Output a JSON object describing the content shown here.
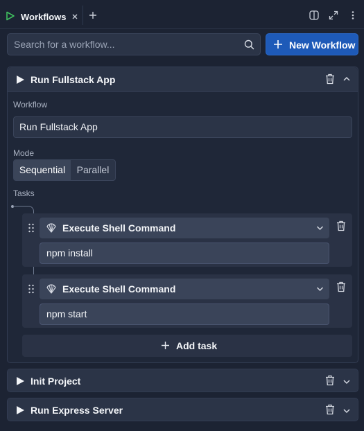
{
  "tabs": [
    {
      "label": "Workflows"
    }
  ],
  "toolbar": {
    "search_placeholder": "Search for a workflow...",
    "new_button_label": "New Workflow"
  },
  "workflows": [
    {
      "name": "Run Fullstack App",
      "expanded": true,
      "workflow_label": "Workflow",
      "workflow_value": "Run Fullstack App",
      "mode_label": "Mode",
      "modes": [
        "Sequential",
        "Parallel"
      ],
      "selected_mode": "Sequential",
      "tasks_label": "Tasks",
      "tasks": [
        {
          "type": "Execute Shell Command",
          "command": "npm install"
        },
        {
          "type": "Execute Shell Command",
          "command": "npm start"
        }
      ],
      "add_task_label": "Add task"
    },
    {
      "name": "Init Project",
      "expanded": false
    },
    {
      "name": "Run Express Server",
      "expanded": false
    }
  ],
  "colors": {
    "background": "#1c2333",
    "accent": "#1e5ab8",
    "tab_play_icon": "#3fbf5f"
  }
}
